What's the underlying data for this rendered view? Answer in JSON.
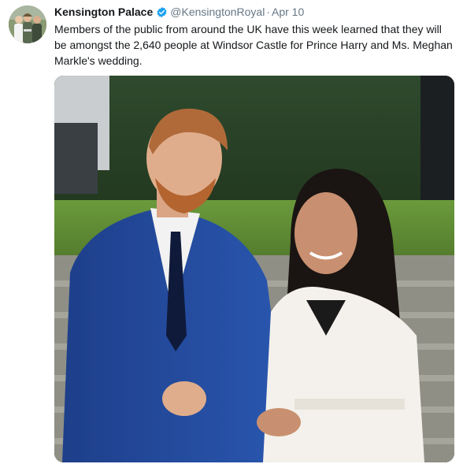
{
  "tweet": {
    "display_name": "Kensington Palace",
    "handle": "@KensingtonRoyal",
    "separator": "·",
    "timestamp": "Apr 10",
    "text": "Members of the public from around the UK have this week learned that they will be amongst the 2,640 people at Windsor Castle for Prince Harry and Ms. Meghan Markle's wedding.",
    "verified_icon": "verified-badge-icon",
    "accent_color": "#1da1f2"
  }
}
